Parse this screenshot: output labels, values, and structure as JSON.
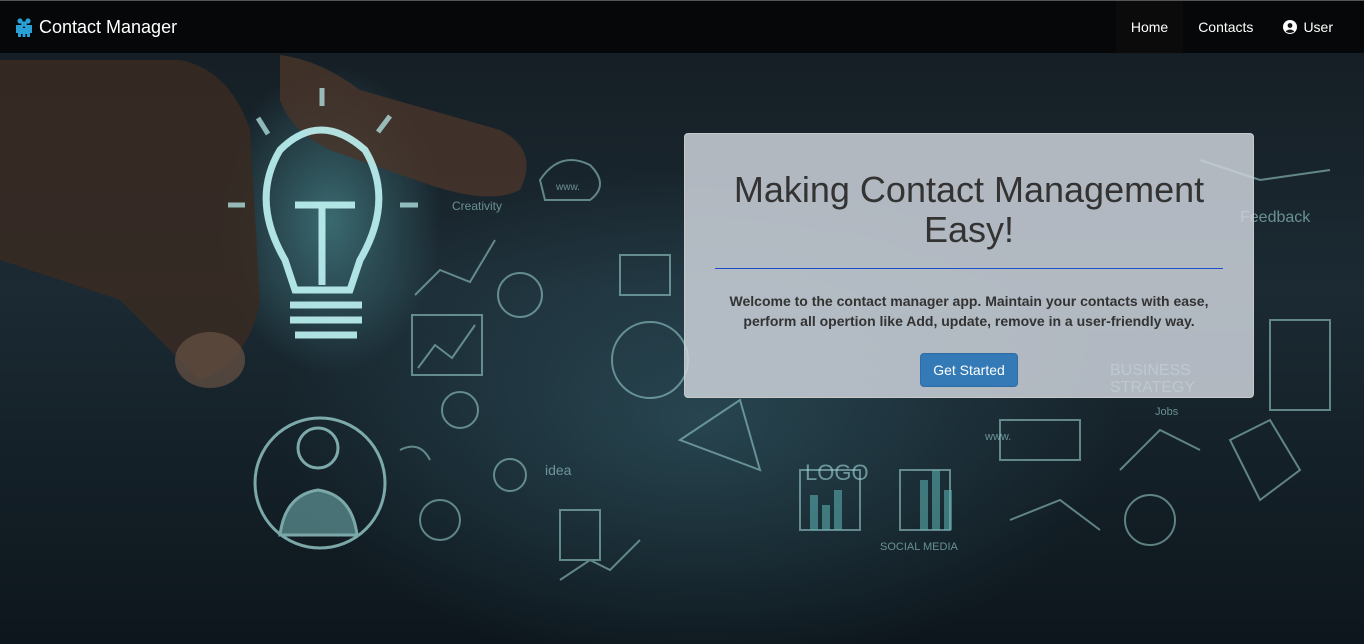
{
  "navbar": {
    "brand": "Contact Manager",
    "brand_icon": "users-icon",
    "items": [
      {
        "label": "Home",
        "active": true
      },
      {
        "label": "Contacts",
        "active": false
      },
      {
        "label": "User",
        "icon": "user-circle-icon",
        "active": false
      }
    ]
  },
  "hero": {
    "title": "Making Contact Management Easy!",
    "description": "Welcome to the contact manager app. Maintain your contacts with ease, perform all opertion like Add, update, remove in a user-friendly way.",
    "cta_label": "Get Started"
  },
  "colors": {
    "accent": "#337ab7",
    "brand_icon": "#2a9fd6",
    "divider": "#1d4ec8"
  }
}
